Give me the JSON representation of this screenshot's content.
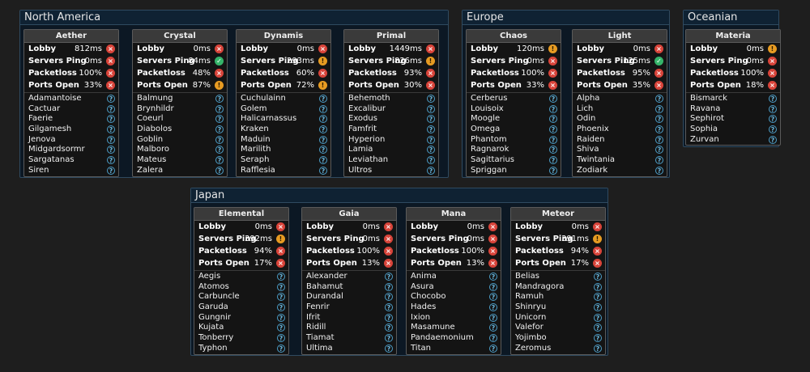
{
  "regions": [
    {
      "name": "North America",
      "datacenters": [
        {
          "name": "Aether",
          "stats": [
            {
              "label": "Lobby",
              "value": "812ms",
              "status": "bad"
            },
            {
              "label": "Servers Ping",
              "value": "0ms",
              "status": "bad"
            },
            {
              "label": "Packetloss",
              "value": "100%",
              "status": "bad"
            },
            {
              "label": "Ports Open",
              "value": "33%",
              "status": "bad"
            }
          ],
          "worlds": [
            "Adamantoise",
            "Cactuar",
            "Faerie",
            "Gilgamesh",
            "Jenova",
            "Midgardsormr",
            "Sargatanas",
            "Siren"
          ]
        },
        {
          "name": "Crystal",
          "stats": [
            {
              "label": "Lobby",
              "value": "0ms",
              "status": "bad"
            },
            {
              "label": "Servers Ping",
              "value": "84ms",
              "status": "ok"
            },
            {
              "label": "Packetloss",
              "value": "48%",
              "status": "bad"
            },
            {
              "label": "Ports Open",
              "value": "87%",
              "status": "warn"
            }
          ],
          "worlds": [
            "Balmung",
            "Brynhildr",
            "Coeurl",
            "Diabolos",
            "Goblin",
            "Malboro",
            "Mateus",
            "Zalera"
          ]
        },
        {
          "name": "Dynamis",
          "stats": [
            {
              "label": "Lobby",
              "value": "0ms",
              "status": "bad"
            },
            {
              "label": "Servers Ping",
              "value": "293ms",
              "status": "warn"
            },
            {
              "label": "Packetloss",
              "value": "60%",
              "status": "bad"
            },
            {
              "label": "Ports Open",
              "value": "72%",
              "status": "warn"
            }
          ],
          "worlds": [
            "Cuchulainn",
            "Golem",
            "Halicarnassus",
            "Kraken",
            "Maduin",
            "Marilith",
            "Seraph",
            "Rafflesia"
          ]
        },
        {
          "name": "Primal",
          "stats": [
            {
              "label": "Lobby",
              "value": "1449ms",
              "status": "bad"
            },
            {
              "label": "Servers Ping",
              "value": "826ms",
              "status": "warn"
            },
            {
              "label": "Packetloss",
              "value": "93%",
              "status": "bad"
            },
            {
              "label": "Ports Open",
              "value": "30%",
              "status": "bad"
            }
          ],
          "worlds": [
            "Behemoth",
            "Excalibur",
            "Exodus",
            "Famfrit",
            "Hyperion",
            "Lamia",
            "Leviathan",
            "Ultros"
          ]
        }
      ]
    },
    {
      "name": "Europe",
      "datacenters": [
        {
          "name": "Chaos",
          "stats": [
            {
              "label": "Lobby",
              "value": "120ms",
              "status": "warn"
            },
            {
              "label": "Servers Ping",
              "value": "0ms",
              "status": "bad"
            },
            {
              "label": "Packetloss",
              "value": "100%",
              "status": "bad"
            },
            {
              "label": "Ports Open",
              "value": "33%",
              "status": "bad"
            }
          ],
          "worlds": [
            "Cerberus",
            "Louisoix",
            "Moogle",
            "Omega",
            "Phantom",
            "Ragnarok",
            "Sagittarius",
            "Spriggan"
          ]
        },
        {
          "name": "Light",
          "stats": [
            {
              "label": "Lobby",
              "value": "0ms",
              "status": "bad"
            },
            {
              "label": "Servers Ping",
              "value": "125ms",
              "status": "ok"
            },
            {
              "label": "Packetloss",
              "value": "95%",
              "status": "bad"
            },
            {
              "label": "Ports Open",
              "value": "35%",
              "status": "bad"
            }
          ],
          "worlds": [
            "Alpha",
            "Lich",
            "Odin",
            "Phoenix",
            "Raiden",
            "Shiva",
            "Twintania",
            "Zodiark"
          ]
        }
      ]
    },
    {
      "name": "Oceanian",
      "datacenters": [
        {
          "name": "Materia",
          "stats": [
            {
              "label": "Lobby",
              "value": "0ms",
              "status": "warn"
            },
            {
              "label": "Servers Ping",
              "value": "0ms",
              "status": "bad"
            },
            {
              "label": "Packetloss",
              "value": "100%",
              "status": "bad"
            },
            {
              "label": "Ports Open",
              "value": "18%",
              "status": "bad"
            }
          ],
          "worlds": [
            "Bismarck",
            "Ravana",
            "Sephirot",
            "Sophia",
            "Zurvan"
          ]
        }
      ]
    },
    {
      "name": "Japan",
      "datacenters": [
        {
          "name": "Elemental",
          "stats": [
            {
              "label": "Lobby",
              "value": "0ms",
              "status": "bad"
            },
            {
              "label": "Servers Ping",
              "value": "392ms",
              "status": "warn"
            },
            {
              "label": "Packetloss",
              "value": "94%",
              "status": "bad"
            },
            {
              "label": "Ports Open",
              "value": "17%",
              "status": "bad"
            }
          ],
          "worlds": [
            "Aegis",
            "Atomos",
            "Carbuncle",
            "Garuda",
            "Gungnir",
            "Kujata",
            "Tonberry",
            "Typhon"
          ]
        },
        {
          "name": "Gaia",
          "stats": [
            {
              "label": "Lobby",
              "value": "0ms",
              "status": "bad"
            },
            {
              "label": "Servers Ping",
              "value": "0ms",
              "status": "bad"
            },
            {
              "label": "Packetloss",
              "value": "100%",
              "status": "bad"
            },
            {
              "label": "Ports Open",
              "value": "13%",
              "status": "bad"
            }
          ],
          "worlds": [
            "Alexander",
            "Bahamut",
            "Durandal",
            "Fenrir",
            "Ifrit",
            "Ridill",
            "Tiamat",
            "Ultima"
          ]
        },
        {
          "name": "Mana",
          "stats": [
            {
              "label": "Lobby",
              "value": "0ms",
              "status": "bad"
            },
            {
              "label": "Servers Ping",
              "value": "0ms",
              "status": "bad"
            },
            {
              "label": "Packetloss",
              "value": "100%",
              "status": "bad"
            },
            {
              "label": "Ports Open",
              "value": "13%",
              "status": "bad"
            }
          ],
          "worlds": [
            "Anima",
            "Asura",
            "Chocobo",
            "Hades",
            "Ixion",
            "Masamune",
            "Pandaemonium",
            "Titan"
          ]
        },
        {
          "name": "Meteor",
          "stats": [
            {
              "label": "Lobby",
              "value": "0ms",
              "status": "bad"
            },
            {
              "label": "Servers Ping",
              "value": "391ms",
              "status": "warn"
            },
            {
              "label": "Packetloss",
              "value": "94%",
              "status": "bad"
            },
            {
              "label": "Ports Open",
              "value": "17%",
              "status": "bad"
            }
          ],
          "worlds": [
            "Belias",
            "Mandragora",
            "Ramuh",
            "Shinryu",
            "Unicorn",
            "Valefor",
            "Yojimbo",
            "Zeromus"
          ]
        }
      ]
    }
  ],
  "status_icons": {
    "bad": {
      "glyph": "×",
      "icon": "error-icon",
      "color": "#d9443a"
    },
    "warn": {
      "glyph": "!",
      "icon": "warning-icon",
      "color": "#e79b22"
    },
    "ok": {
      "glyph": "✓",
      "icon": "ok-icon",
      "color": "#35b46a"
    },
    "unknown": {
      "glyph": "?",
      "icon": "unknown-status-icon",
      "color": "#4c9ec8"
    }
  }
}
